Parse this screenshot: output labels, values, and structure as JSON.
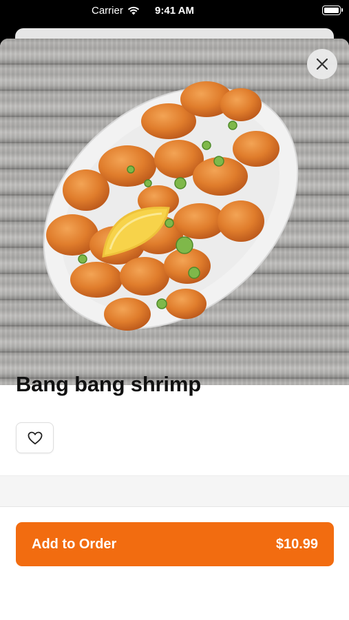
{
  "status_bar": {
    "carrier": "Carrier",
    "time": "9:41 AM"
  },
  "item": {
    "name": "Bang bang shrimp",
    "image_alt": "Bang bang shrimp on white oval plate with lemon wedge and green onions"
  },
  "actions": {
    "add_label": "Add to Order",
    "price": "$10.99"
  },
  "icons": {
    "close": "close-icon",
    "favorite": "heart-outline-icon",
    "wifi": "wifi-icon",
    "battery": "battery-icon"
  },
  "colors": {
    "accent": "#f26c10"
  }
}
